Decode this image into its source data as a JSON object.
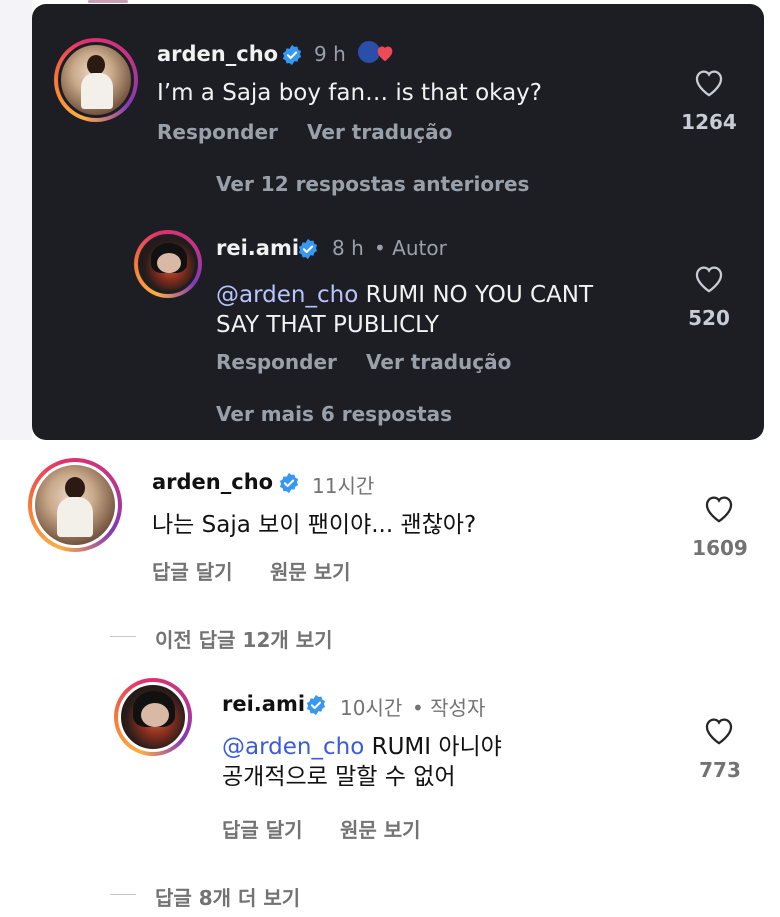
{
  "pt": {
    "comment": {
      "username": "arden_cho",
      "time": "9 h",
      "text": "I’m a Saja boy fan… is that okay?",
      "reply_label": "Responder",
      "translate_label": "Ver tradução",
      "likes": "1264"
    },
    "view_previous": "Ver 12 respostas anteriores",
    "reply": {
      "username": "rei.ami",
      "time": "8 h",
      "author_tag": "• Autor",
      "mention": "@arden_cho",
      "text_line1": " RUMI NO YOU CANT",
      "text_line2": "SAY THAT PUBLICLY",
      "reply_label": "Responder",
      "translate_label": "Ver tradução",
      "likes": "520"
    },
    "view_more": "Ver mais 6 respostas"
  },
  "ko": {
    "comment": {
      "username": "arden_cho",
      "time": "11시간",
      "text": "나는 Saja 보이 팬이야... 괜찮아?",
      "reply_label": "답글 달기",
      "translate_label": "원문 보기",
      "likes": "1609"
    },
    "view_previous": "이전 답글 12개 보기",
    "reply": {
      "username": "rei.ami",
      "time": "10시간",
      "author_tag": "• 작성자",
      "mention": "@arden_cho",
      "text_line1": " RUMI 아니야",
      "text_line2": "공개적으로 말할 수 없어",
      "reply_label": "답글 달기",
      "translate_label": "원문 보기",
      "likes": "773"
    },
    "view_more": "답글 8개 더 보기"
  },
  "colors": {
    "dark_bg": "#1c1e24",
    "verified_blue": "#3897f0",
    "mention_dark": "#b9c4ff",
    "mention_light": "#3b5bdb",
    "heart_red": "#ed4956"
  },
  "icons": [
    "verified-badge-icon",
    "heart-icon",
    "reaction-heart-icon"
  ]
}
